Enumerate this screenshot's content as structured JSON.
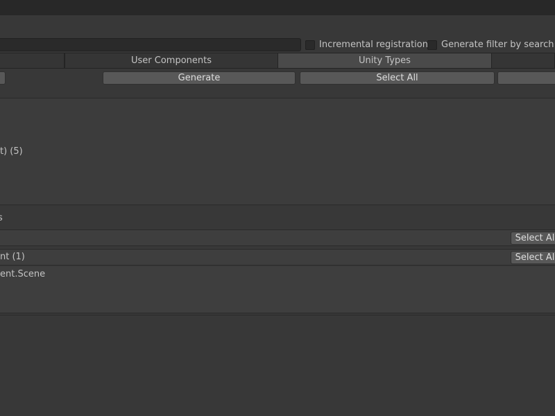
{
  "options": {
    "incremental_registration": "Incremental registration",
    "generate_filter_by_search": "Generate filter by search"
  },
  "tabs": [
    {
      "label": ""
    },
    {
      "label": "User Components"
    },
    {
      "label": "Unity Types"
    },
    {
      "label": ""
    }
  ],
  "actions": {
    "generate_label": "Generate",
    "select_all_label": "Select All"
  },
  "top_panel": {
    "item_text": "t) (5)"
  },
  "list": {
    "header_text": "s",
    "row2_text": "nt (1)",
    "row_button_label": "Select Al",
    "detail_text": "ent.Scene"
  }
}
